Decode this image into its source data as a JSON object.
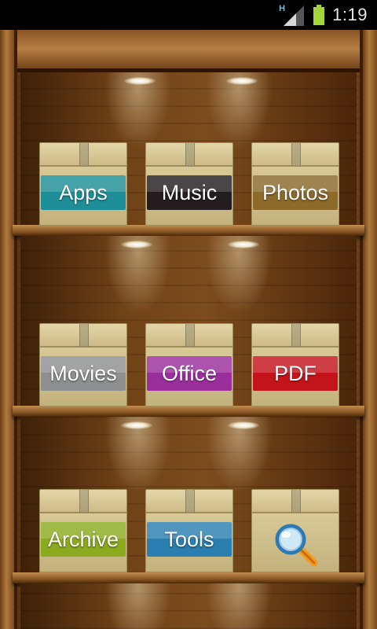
{
  "status_bar": {
    "network_type": "H",
    "time": "1:19",
    "colors": {
      "battery": "#a4d43a"
    }
  },
  "shelves": [
    {
      "boxes": [
        {
          "id": "apps",
          "label": "Apps",
          "color": "#1e8f98"
        },
        {
          "id": "music",
          "label": "Music",
          "color": "#231d1e"
        },
        {
          "id": "photos",
          "label": "Photos",
          "color": "#8c6a2a"
        }
      ]
    },
    {
      "boxes": [
        {
          "id": "movies",
          "label": "Movies",
          "color": "#8e8f90"
        },
        {
          "id": "office",
          "label": "Office",
          "color": "#9a2f9c"
        },
        {
          "id": "pdf",
          "label": "PDF",
          "color": "#c4141b"
        }
      ]
    },
    {
      "boxes": [
        {
          "id": "archive",
          "label": "Archive",
          "color": "#8bab1f"
        },
        {
          "id": "tools",
          "label": "Tools",
          "color": "#2a7fb0"
        },
        {
          "id": "search",
          "label": "",
          "icon": "search-icon"
        }
      ]
    }
  ]
}
